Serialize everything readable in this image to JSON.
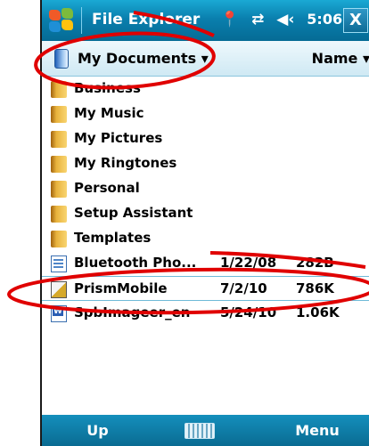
{
  "title_bar": {
    "app_title": "File Explorer",
    "time": "5:06",
    "close_label": "X",
    "icons": [
      "windows-flag-icon",
      "signal-icon",
      "connectivity-icon",
      "volume-icon"
    ]
  },
  "header": {
    "folder": "My Documents",
    "folder_caret": "▾",
    "sort_by": "Name",
    "sort_caret": "▾"
  },
  "files": [
    {
      "name": "Business",
      "type": "folder",
      "date": "",
      "size": ""
    },
    {
      "name": "My Music",
      "type": "folder",
      "date": "",
      "size": ""
    },
    {
      "name": "My Pictures",
      "type": "folder",
      "date": "",
      "size": ""
    },
    {
      "name": "My Ringtones",
      "type": "folder",
      "date": "",
      "size": ""
    },
    {
      "name": "Personal",
      "type": "folder",
      "date": "",
      "size": ""
    },
    {
      "name": "Setup Assistant",
      "type": "folder",
      "date": "",
      "size": ""
    },
    {
      "name": "Templates",
      "type": "folder",
      "date": "",
      "size": ""
    },
    {
      "name": "Bluetooth Pho...",
      "type": "document",
      "date": "1/22/08",
      "size": "282B"
    },
    {
      "name": "PrismMobile",
      "type": "application",
      "date": "7/2/10",
      "size": "786K",
      "selected": true
    },
    {
      "name": "SpbImageer_en",
      "type": "word-document",
      "date": "5/24/10",
      "size": "1.06K"
    }
  ],
  "softkeys": {
    "left": "Up",
    "right": "Menu"
  },
  "colors": {
    "title_bar": "#0a7fae",
    "header_bg": "#dff1f8",
    "annotation": "#e00000"
  }
}
